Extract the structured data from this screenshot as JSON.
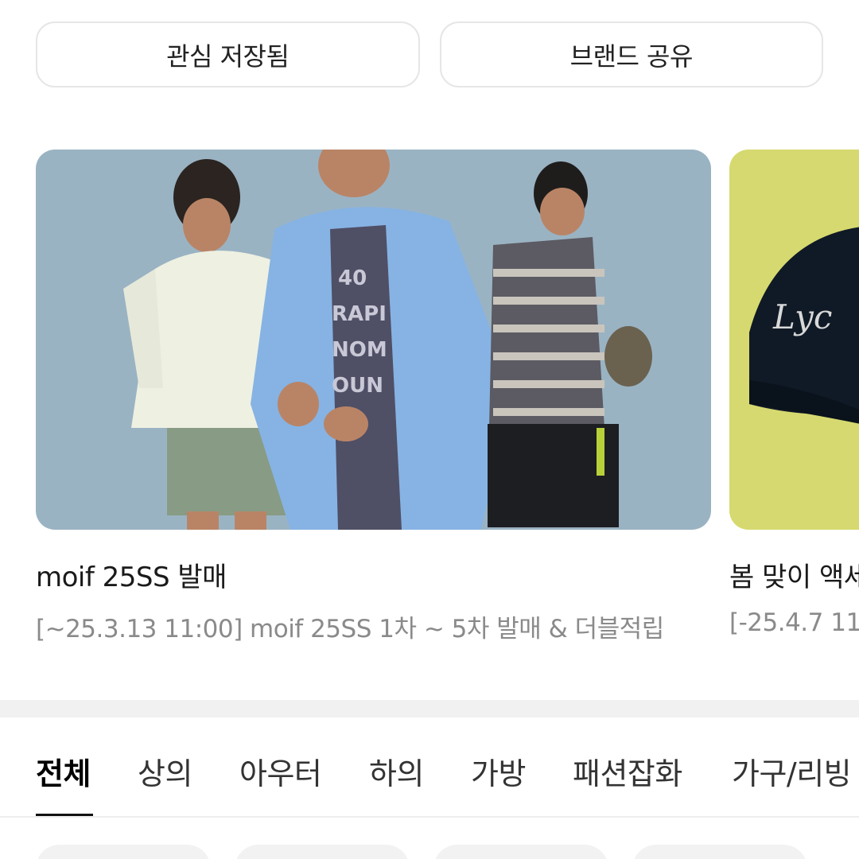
{
  "actions": {
    "favorite_label": "관심 저장됨",
    "share_label": "브랜드 공유"
  },
  "cards": [
    {
      "title": "moif 25SS 발매",
      "desc": "[~25.3.13 11:00] moif 25SS 1차 ~ 5차 발매 & 더블적립",
      "image": "three-models-streetwear-photo"
    },
    {
      "title": "봄 맞이 액세",
      "desc": "[-25.4.7 11",
      "image": "navy-cap-photo"
    }
  ],
  "tabs": [
    {
      "label": "전체",
      "active": true
    },
    {
      "label": "상의"
    },
    {
      "label": "아우터"
    },
    {
      "label": "하의"
    },
    {
      "label": "가방"
    },
    {
      "label": "패션잡화"
    },
    {
      "label": "가구/리빙"
    }
  ],
  "colors": {
    "banner_1_bg": "#9ab3c3",
    "banner_2_bg": "#d6d96f",
    "active_tab": "#111111"
  }
}
